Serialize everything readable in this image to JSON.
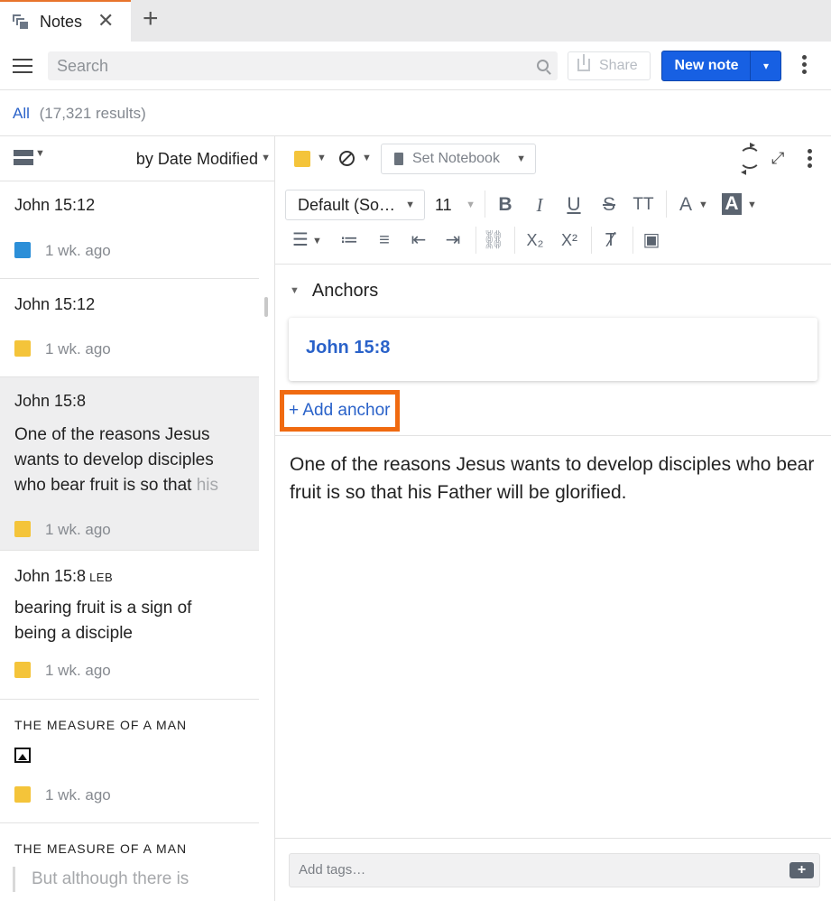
{
  "tab": {
    "title": "Notes",
    "close_symbol": "✕",
    "new_tab_symbol": "+"
  },
  "toolbar": {
    "search_placeholder": "Search",
    "share_label": "Share",
    "new_note_label": "New note",
    "new_note_caret": "▾"
  },
  "filter": {
    "all_label": "All",
    "count_text": "(17,321 results)"
  },
  "list_header": {
    "sort_label": "by Date Modified",
    "caret": "⌄"
  },
  "notes": [
    {
      "title": "John 15:12",
      "meta": "1 wk. ago",
      "color": "#2c8fd8"
    },
    {
      "title": "John 15:12",
      "meta": "1 wk. ago",
      "color": "#f4c43a"
    },
    {
      "title": "John 15:8",
      "body_main": "One of the reasons Jesus wants to develop disciples who bear fruit is so that ",
      "body_fade": "his",
      "meta": "1 wk. ago",
      "color": "#f4c43a"
    },
    {
      "title": "John 15:8",
      "ref": "LEB",
      "body_main": "bearing fruit is a sign of being a disciple",
      "meta": "1 wk. ago",
      "color": "#f4c43a"
    },
    {
      "title": "THE MEASURE OF A MAN",
      "meta": "1 wk. ago",
      "color": "#f4c43a"
    },
    {
      "title": "THE MEASURE OF A MAN",
      "quote": "But although there is"
    }
  ],
  "editor_toolbar": {
    "set_notebook_label": "Set Notebook"
  },
  "format": {
    "font_label": "Default (So…",
    "size_label": "11",
    "bold": "B",
    "italic": "I",
    "underline": "U",
    "strike": "S",
    "textsize": "TT",
    "fontcolor": "A",
    "highlight": "A",
    "subscript": "X₂",
    "superscript": "X²"
  },
  "anchors": {
    "heading": "Anchors",
    "chevron": "⌄",
    "items": [
      "John 15:8"
    ],
    "add_label": "+ Add anchor"
  },
  "note": {
    "body": "One of the reasons Jesus wants to develop disciples who bear fruit is so that his Father will be glorified."
  },
  "tags": {
    "placeholder": "Add tags…",
    "add_symbol": "+"
  }
}
